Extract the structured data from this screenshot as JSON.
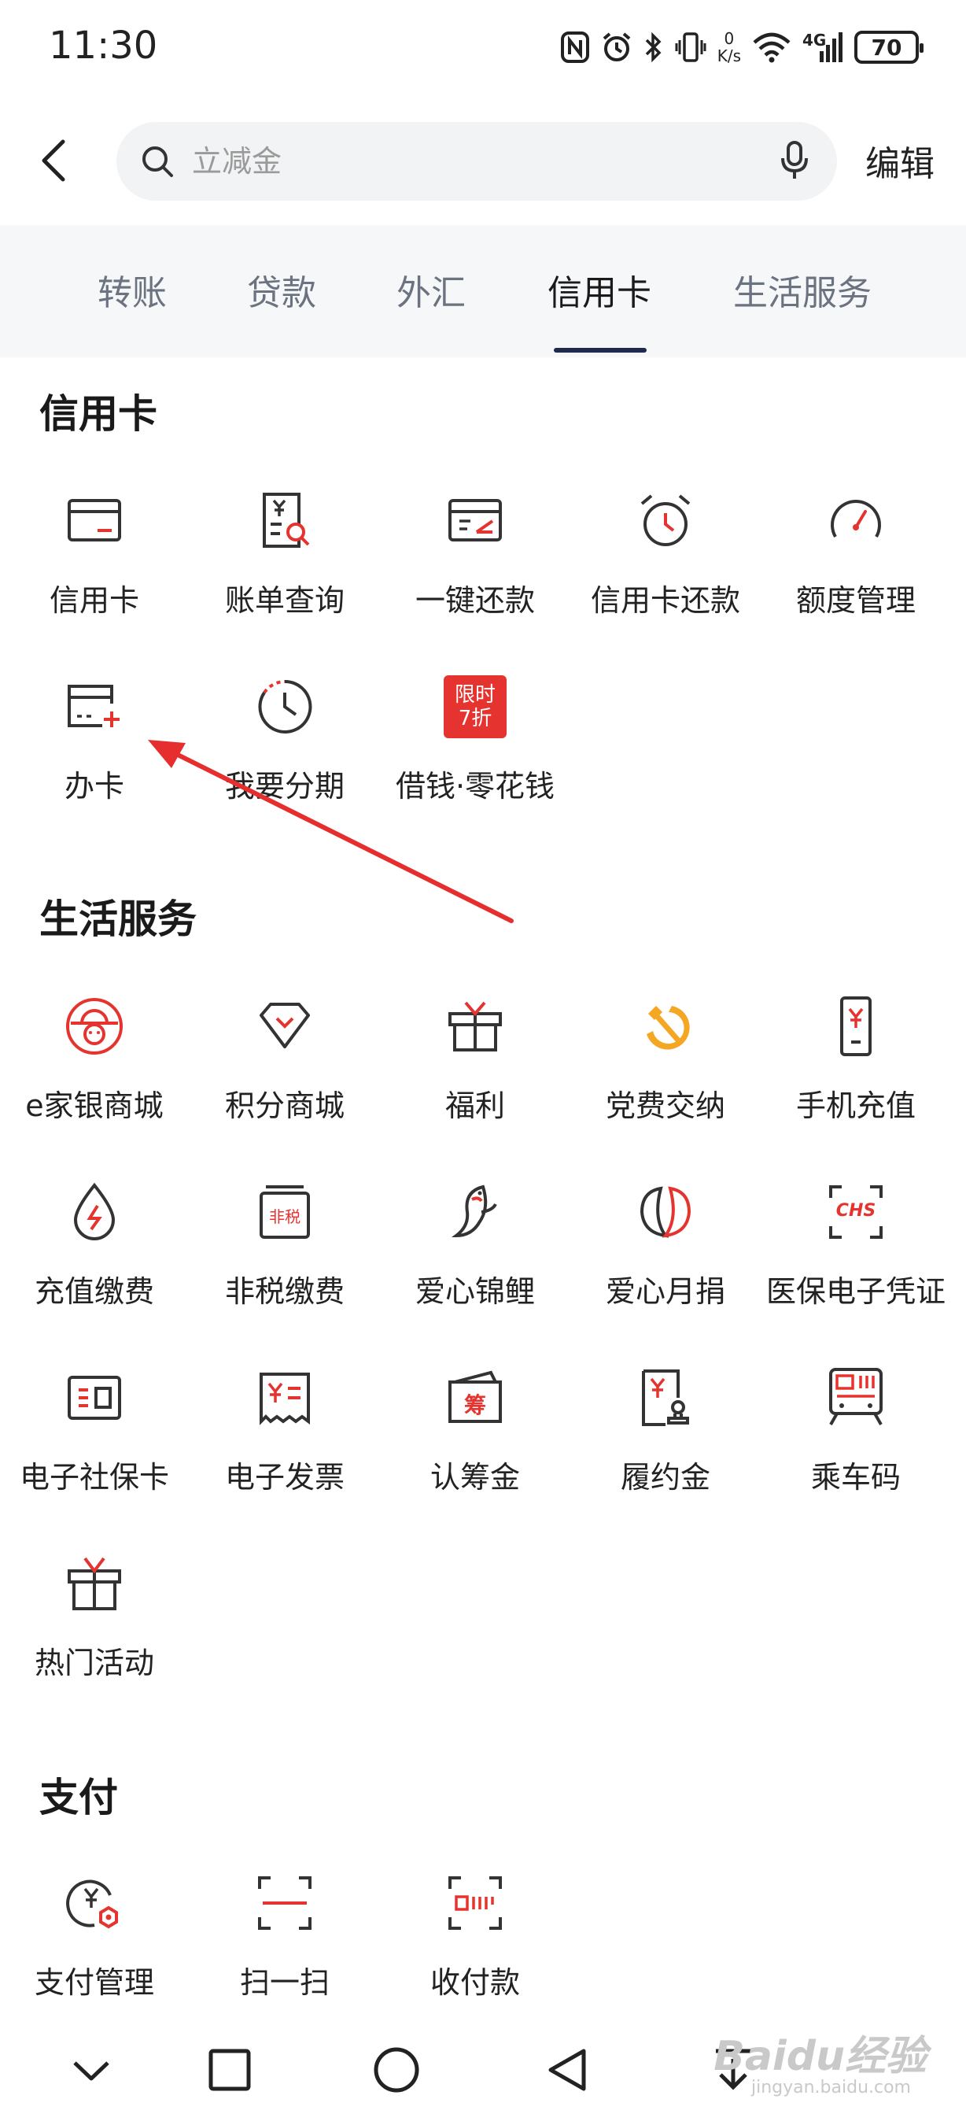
{
  "status_bar": {
    "time": "11:30",
    "net_speed_value": "0",
    "net_speed_unit": "K/s",
    "network_type": "4G",
    "battery": "70"
  },
  "search": {
    "placeholder": "立减金",
    "edit_label": "编辑"
  },
  "tabs": [
    {
      "label": "转账"
    },
    {
      "label": "贷款"
    },
    {
      "label": "外汇"
    },
    {
      "label": "信用卡",
      "active": true
    },
    {
      "label": "生活服务"
    }
  ],
  "sections": {
    "credit": {
      "title": "信用卡",
      "items": [
        {
          "label": "信用卡",
          "icon": "credit-card-icon"
        },
        {
          "label": "账单查询",
          "icon": "bill-query-icon"
        },
        {
          "label": "一键还款",
          "icon": "one-click-repay-icon"
        },
        {
          "label": "信用卡还款",
          "icon": "alarm-clock-icon"
        },
        {
          "label": "额度管理",
          "icon": "gauge-icon"
        },
        {
          "label": "办卡",
          "icon": "card-add-icon"
        },
        {
          "label": "我要分期",
          "icon": "installment-clock-icon"
        },
        {
          "label": "借钱·零花钱",
          "icon": "promo-badge-icon",
          "badge_line1": "限时",
          "badge_line2": "7折"
        }
      ]
    },
    "life": {
      "title": "生活服务",
      "items": [
        {
          "label": "e家银商城",
          "icon": "mall-icon"
        },
        {
          "label": "积分商城",
          "icon": "diamond-icon"
        },
        {
          "label": "福利",
          "icon": "gift-icon"
        },
        {
          "label": "党费交纳",
          "icon": "hammer-sickle-icon"
        },
        {
          "label": "手机充值",
          "icon": "phone-recharge-icon"
        },
        {
          "label": "充值缴费",
          "icon": "drop-bolt-icon"
        },
        {
          "label": "非税缴费",
          "icon": "non-tax-icon",
          "badge_text": "非税"
        },
        {
          "label": "爱心锦鲤",
          "icon": "koi-fish-icon"
        },
        {
          "label": "爱心月捐",
          "icon": "donation-icon"
        },
        {
          "label": "医保电子凭证",
          "icon": "medical-insurance-icon",
          "badge_text": "CHS"
        },
        {
          "label": "电子社保卡",
          "icon": "social-security-card-icon"
        },
        {
          "label": "电子发票",
          "icon": "invoice-icon"
        },
        {
          "label": "认筹金",
          "icon": "fundraise-icon",
          "badge_text": "筹"
        },
        {
          "label": "履约金",
          "icon": "deposit-icon"
        },
        {
          "label": "乘车码",
          "icon": "transit-code-icon"
        },
        {
          "label": "热门活动",
          "icon": "hot-activity-icon"
        }
      ]
    },
    "pay": {
      "title": "支付",
      "items": [
        {
          "label": "支付管理",
          "icon": "pay-manage-icon"
        },
        {
          "label": "扫一扫",
          "icon": "scan-icon"
        },
        {
          "label": "收付款",
          "icon": "receive-pay-icon"
        }
      ]
    }
  },
  "watermark": {
    "brand": "Baidu经验",
    "domain": "jingyan.baidu.com"
  },
  "colors": {
    "accent_red": "#e5342f",
    "icon_dark": "#333333",
    "tab_indicator": "#1e2b4d",
    "party_orange": "#f5a623",
    "annotation_arrow": "#e62e2e"
  }
}
